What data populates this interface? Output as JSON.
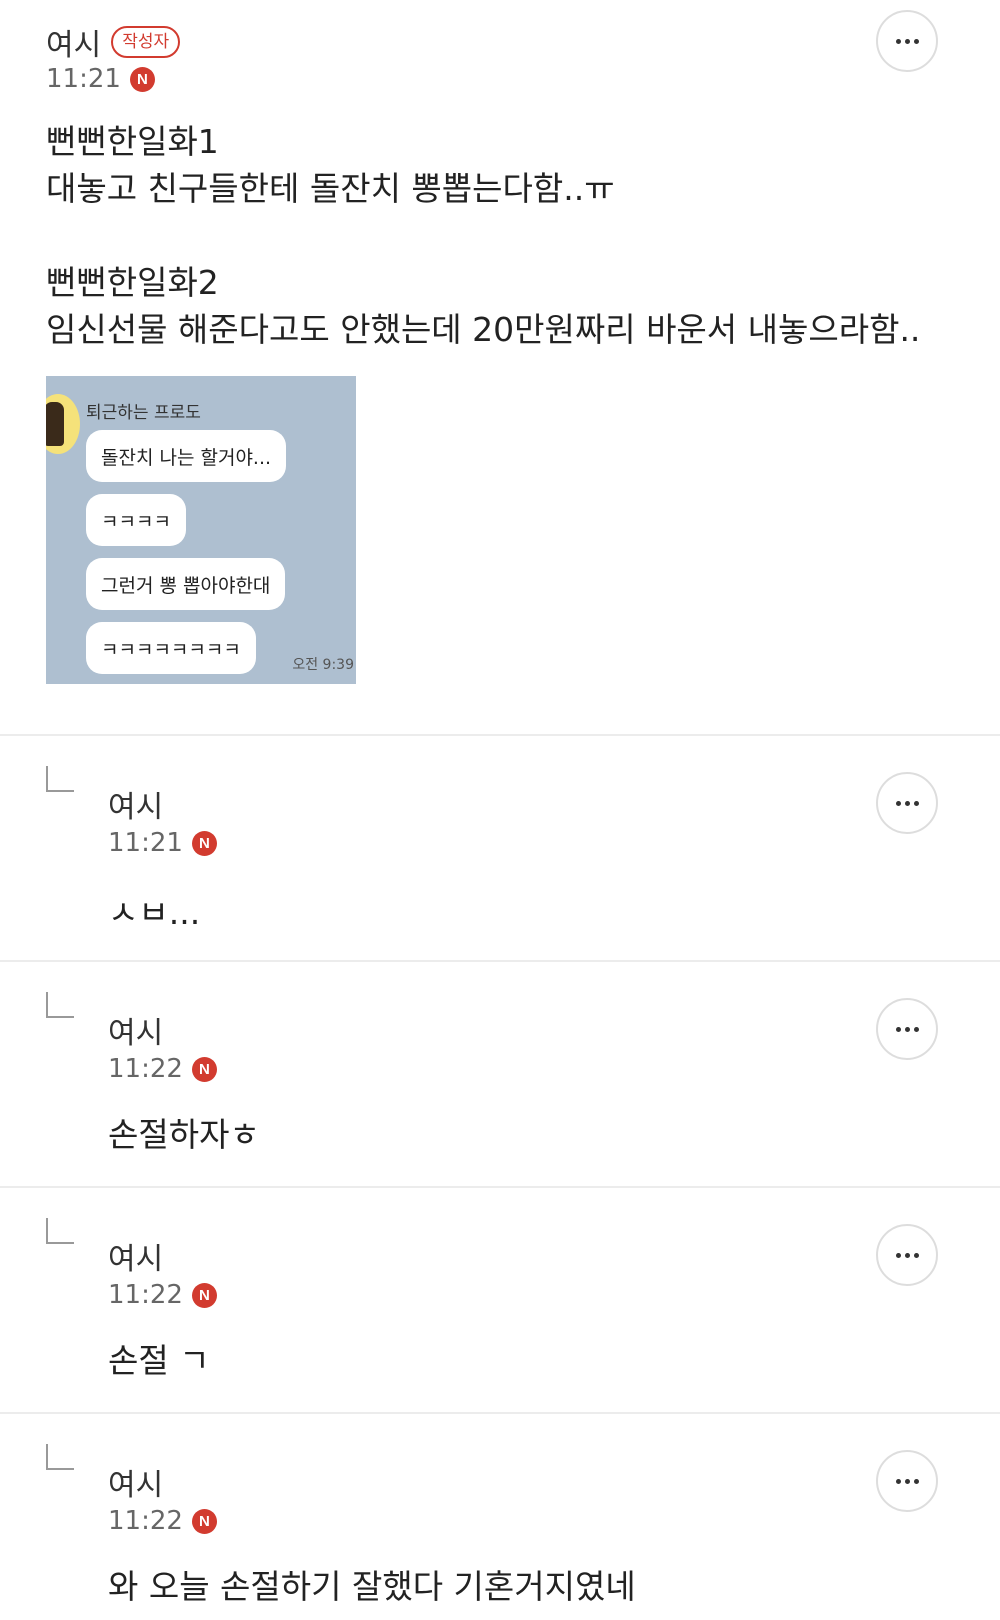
{
  "post": {
    "author": "여시",
    "writer_badge": "작성자",
    "time": "11:21",
    "new_badge": "N",
    "body_lines": [
      "뻔뻔한일화1",
      "대놓고 친구들한테 돌잔치 뽕뽑는다함..ㅠ",
      "",
      "뻔뻔한일화2",
      "임신선물 해준다고도 안했는데 20만원짜리 바운서 내놓으라함.."
    ],
    "chat_image": {
      "sender": "퇴근하는 프로도",
      "messages": [
        "돌잔치 나는 할거야...",
        "ㅋㅋㅋㅋ",
        "그런거 뽕 뽑아야한대",
        "ㅋㅋㅋㅋㅋㅋㅋㅋ"
      ],
      "time": "오전 9:39"
    },
    "more_icon": "more-horizontal-icon"
  },
  "replies": [
    {
      "author": "여시",
      "time": "11:21",
      "new_badge": "N",
      "text": "ㅅㅂ..."
    },
    {
      "author": "여시",
      "time": "11:22",
      "new_badge": "N",
      "text": "손절하자ㅎ"
    },
    {
      "author": "여시",
      "time": "11:22",
      "new_badge": "N",
      "text": "손절 ㄱ"
    },
    {
      "author": "여시",
      "time": "11:22",
      "new_badge": "N",
      "text": "와 오늘 손절하기 잘했다 기혼거지였네"
    }
  ],
  "colors": {
    "accent_red": "#d23b2f",
    "chat_background": "#aebfd0",
    "divider": "#ececec"
  }
}
